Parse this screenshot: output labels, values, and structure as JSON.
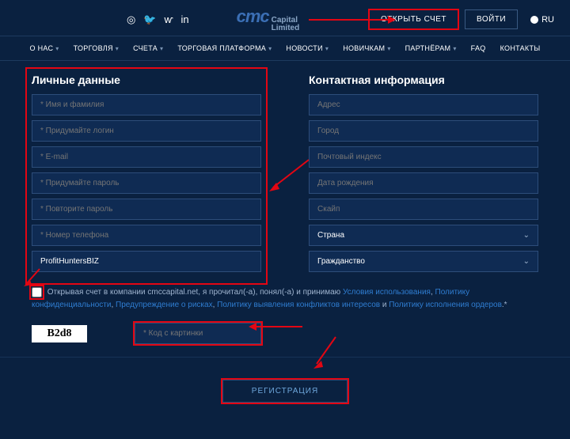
{
  "header": {
    "logo_main": "cmc",
    "logo_sub1": "Capital",
    "logo_sub2": "Limited",
    "open_account": "ОТКРЫТЬ СЧЕТ",
    "login": "ВОЙТИ",
    "lang": "RU"
  },
  "nav": {
    "about": "О НАС",
    "trading": "ТОРГОВЛЯ",
    "accounts": "СЧЕТА",
    "platform": "ТОРГОВАЯ ПЛАТФОРМА",
    "news": "НОВОСТИ",
    "newbies": "НОВИЧКАМ",
    "partners": "ПАРТНЁРАМ",
    "faq": "FAQ",
    "contacts": "КОНТАКТЫ"
  },
  "form": {
    "personal_title": "Личные данные",
    "contact_title": "Контактная информация",
    "name": "* Имя и фамилия",
    "login": "* Придумайте логин",
    "email": "* E-mail",
    "password": "* Придумайте пароль",
    "password2": "* Повторите пароль",
    "phone": "* Номер телефона",
    "ref": "ProfitHuntersBIZ",
    "address": "Адрес",
    "city": "Город",
    "zip": "Почтовый индекс",
    "dob": "Дата рождения",
    "skype": "Скайп",
    "country": "Страна",
    "citizenship": "Гражданство"
  },
  "terms": {
    "pre": "Открывая счет в компании cmccapital.net, я прочитал(-а), понял(-а) и принимаю ",
    "link1": "Условия использования",
    "sep1": ", ",
    "link2": "Политику конфиденциальности",
    "sep2": ", ",
    "link3": "Предупреждение о рисках",
    "sep3": ", ",
    "link4": "Политику выявления конфликтов интересов",
    "sep4": " и ",
    "link5": "Политику исполнения ордеров",
    "post": ".*"
  },
  "captcha": {
    "img_text": "B2d8",
    "placeholder": "* Код с картинки"
  },
  "submit": "РЕГИСТРАЦИЯ"
}
